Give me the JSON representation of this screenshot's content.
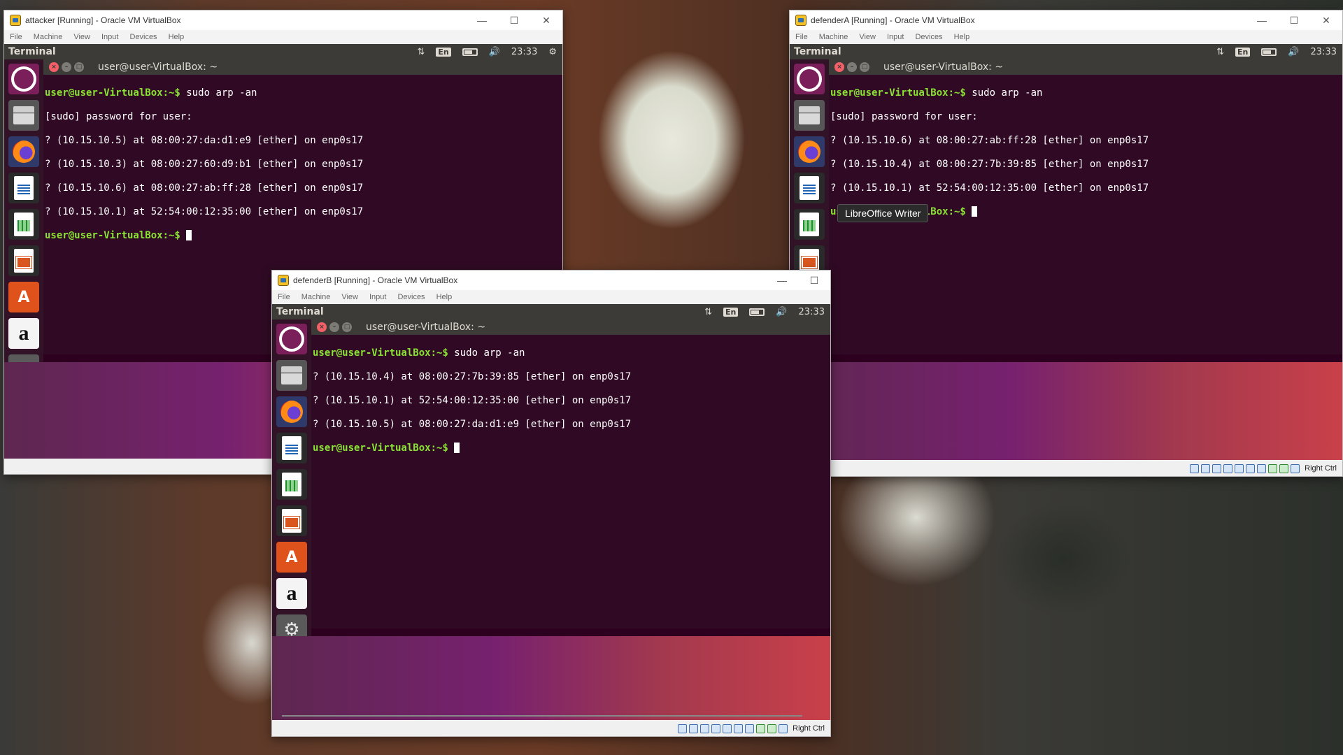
{
  "vbox_menu": [
    "File",
    "Machine",
    "View",
    "Input",
    "Devices",
    "Help"
  ],
  "window_controls": {
    "minimize": "—",
    "maximize": "☐",
    "close": "✕"
  },
  "guest_topbar": {
    "app_name": "Terminal",
    "keyboard": "En",
    "time": "23:33"
  },
  "terminal_title": "user@user-VirtualBox: ~",
  "status_bar": {
    "host_key": "Right Ctrl"
  },
  "launcher_icons": [
    "ubuntu-dash-icon",
    "files-icon",
    "firefox-icon",
    "libreoffice-writer-icon",
    "libreoffice-calc-icon",
    "libreoffice-impress-icon",
    "ubuntu-software-icon",
    "amazon-icon",
    "system-settings-icon",
    "terminal-icon"
  ],
  "windows": {
    "attacker": {
      "title": "attacker [Running] - Oracle VM VirtualBox",
      "prompt": "user@user-VirtualBox:~$",
      "lines": [
        {
          "prompt": "user@user-VirtualBox:~$",
          "text": " sudo arp -an"
        },
        {
          "prompt": "",
          "text": "[sudo] password for user:"
        },
        {
          "prompt": "",
          "text": "? (10.15.10.5) at 08:00:27:da:d1:e9 [ether] on enp0s17"
        },
        {
          "prompt": "",
          "text": "? (10.15.10.3) at 08:00:27:60:d9:b1 [ether] on enp0s17"
        },
        {
          "prompt": "",
          "text": "? (10.15.10.6) at 08:00:27:ab:ff:28 [ether] on enp0s17"
        },
        {
          "prompt": "",
          "text": "? (10.15.10.1) at 52:54:00:12:35:00 [ether] on enp0s17"
        }
      ]
    },
    "defenderA": {
      "title": "defenderA [Running] - Oracle VM VirtualBox",
      "prompt": "user@user-VirtualBox:~$",
      "lines": [
        {
          "prompt": "user@user-VirtualBox:~$",
          "text": " sudo arp -an"
        },
        {
          "prompt": "",
          "text": "[sudo] password for user:"
        },
        {
          "prompt": "",
          "text": "? (10.15.10.6) at 08:00:27:ab:ff:28 [ether] on enp0s17"
        },
        {
          "prompt": "",
          "text": "? (10.15.10.4) at 08:00:27:7b:39:85 [ether] on enp0s17"
        },
        {
          "prompt": "",
          "text": "? (10.15.10.1) at 52:54:00:12:35:00 [ether] on enp0s17"
        }
      ],
      "tooltip": "LibreOffice Writer"
    },
    "defenderB": {
      "title": "defenderB [Running] - Oracle VM VirtualBox",
      "prompt": "user@user-VirtualBox:~$",
      "lines": [
        {
          "prompt": "user@user-VirtualBox:~$",
          "text": " sudo arp -an"
        },
        {
          "prompt": "",
          "text": "? (10.15.10.4) at 08:00:27:7b:39:85 [ether] on enp0s17"
        },
        {
          "prompt": "",
          "text": "? (10.15.10.1) at 52:54:00:12:35:00 [ether] on enp0s17"
        },
        {
          "prompt": "",
          "text": "? (10.15.10.5) at 08:00:27:da:d1:e9 [ether] on enp0s17"
        }
      ]
    }
  }
}
